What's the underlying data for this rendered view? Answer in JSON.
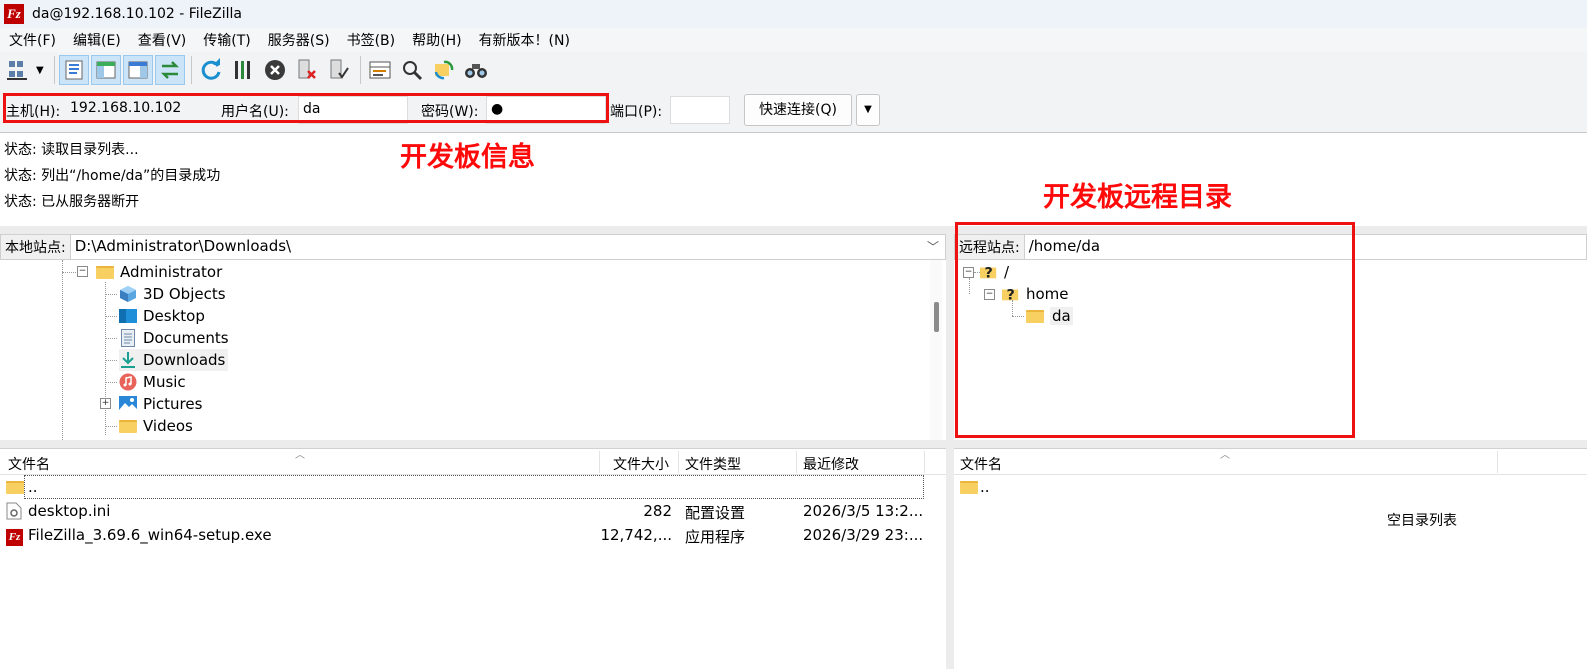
{
  "window": {
    "title": "da@192.168.10.102 - FileZilla",
    "app_icon": "Fz"
  },
  "menu": [
    "文件(F)",
    "编辑(E)",
    "查看(V)",
    "传输(T)",
    "服务器(S)",
    "书签(B)",
    "帮助(H)",
    "有新版本！(N)"
  ],
  "toolbar": {
    "icons": [
      "site-manager-icon",
      "toggle-log-icon",
      "toggle-local-tree-icon",
      "toggle-remote-tree-icon",
      "toggle-queue-icon",
      "refresh-icon",
      "process-queue-icon",
      "cancel-icon",
      "disconnect-icon",
      "reconnect-icon",
      "directory-listing-filters-icon",
      "toggle-sync-browsing-icon",
      "directory-comparison-icon",
      "search-remote-icon"
    ]
  },
  "quickconnect": {
    "host_label": "主机(H):",
    "host_value": "192.168.10.102",
    "user_label": "用户名(U):",
    "user_value": "da",
    "pass_label": "密码(W):",
    "pass_value": "●",
    "port_label": "端口(P):",
    "port_value": "",
    "connect_button": "快速连接(Q)"
  },
  "annotations": {
    "board_info": "开发板信息",
    "board_remote_dir": "开发板远程目录"
  },
  "log": [
    "状态: 读取目录列表...",
    "状态: 列出“/home/da”的目录成功",
    "状态: 已从服务器断开"
  ],
  "local": {
    "site_label": "本地站点:",
    "path": "D:\\Administrator\\Downloads\\",
    "tree": [
      {
        "label": "Administrator",
        "icon": "folder-icon"
      },
      {
        "label": "3D Objects",
        "icon": "3d-objects-icon"
      },
      {
        "label": "Desktop",
        "icon": "desktop-icon"
      },
      {
        "label": "Documents",
        "icon": "documents-icon"
      },
      {
        "label": "Downloads",
        "icon": "downloads-icon"
      },
      {
        "label": "Music",
        "icon": "music-icon"
      },
      {
        "label": "Pictures",
        "icon": "pictures-icon"
      },
      {
        "label": "Videos",
        "icon": "folder-icon"
      }
    ],
    "columns": [
      "文件名",
      "文件大小",
      "文件类型",
      "最近修改"
    ],
    "files": [
      {
        "name": "..",
        "size": "",
        "type": "",
        "modified": "",
        "icon": "folder-icon"
      },
      {
        "name": "desktop.ini",
        "size": "282",
        "type": "配置设置",
        "modified": "2026/3/5 13:2...",
        "icon": "settings-file-icon"
      },
      {
        "name": "FileZilla_3.69.6_win64-setup.exe",
        "size": "12,742,...",
        "type": "应用程序",
        "modified": "2026/3/29 23:...",
        "icon": "filezilla-icon"
      }
    ]
  },
  "remote": {
    "site_label": "远程站点:",
    "path": "/home/da",
    "tree": [
      {
        "label": "/",
        "icon": "unknown-folder-icon"
      },
      {
        "label": "home",
        "icon": "unknown-folder-icon"
      },
      {
        "label": "da",
        "icon": "folder-icon"
      }
    ],
    "columns": [
      "文件名"
    ],
    "files": [
      {
        "name": "..",
        "icon": "folder-icon"
      }
    ],
    "empty_text": "空目录列表"
  }
}
